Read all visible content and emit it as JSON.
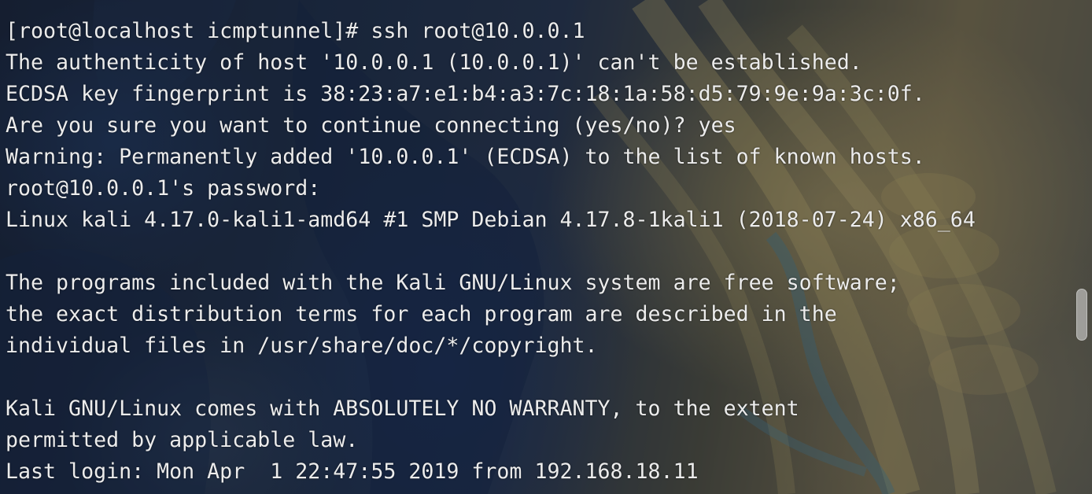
{
  "terminal": {
    "lines": [
      "[root@localhost icmptunnel]# ssh root@10.0.0.1",
      "The authenticity of host '10.0.0.1 (10.0.0.1)' can't be established.",
      "ECDSA key fingerprint is 38:23:a7:e1:b4:a3:7c:18:1a:58:d5:79:9e:9a:3c:0f.",
      "Are you sure you want to continue connecting (yes/no)? yes",
      "Warning: Permanently added '10.0.0.1' (ECDSA) to the list of known hosts.",
      "root@10.0.0.1's password:",
      "Linux kali 4.17.0-kali1-amd64 #1 SMP Debian 4.17.8-1kali1 (2018-07-24) x86_64",
      "",
      "The programs included with the Kali GNU/Linux system are free software;",
      "the exact distribution terms for each program are described in the",
      "individual files in /usr/share/doc/*/copyright.",
      "",
      "Kali GNU/Linux comes with ABSOLUTELY NO WARRANTY, to the extent",
      "permitted by applicable law.",
      "Last login: Mon Apr  1 22:47:55 2019 from 192.168.18.11"
    ]
  },
  "colors": {
    "text": "#ececec",
    "scrollbar_thumb": "#e1e1e1"
  }
}
